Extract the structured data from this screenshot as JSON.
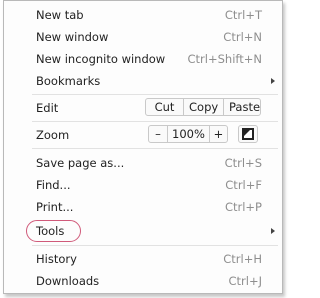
{
  "menu": {
    "new_tab": {
      "label": "New tab",
      "shortcut": "Ctrl+T"
    },
    "new_window": {
      "label": "New window",
      "shortcut": "Ctrl+N"
    },
    "new_incognito": {
      "label": "New incognito window",
      "shortcut": "Ctrl+Shift+N"
    },
    "bookmarks": {
      "label": "Bookmarks"
    },
    "edit": {
      "label": "Edit",
      "cut": "Cut",
      "copy": "Copy",
      "paste": "Paste"
    },
    "zoom": {
      "label": "Zoom",
      "minus": "–",
      "level": "100%",
      "plus": "+"
    },
    "save_page": {
      "label": "Save page as...",
      "shortcut": "Ctrl+S"
    },
    "find": {
      "label": "Find...",
      "shortcut": "Ctrl+F"
    },
    "print": {
      "label": "Print...",
      "shortcut": "Ctrl+P"
    },
    "tools": {
      "label": "Tools"
    },
    "history": {
      "label": "History",
      "shortcut": "Ctrl+H"
    },
    "downloads": {
      "label": "Downloads",
      "shortcut": "Ctrl+J"
    }
  },
  "icons": {
    "submenu_arrow": "triangle-right",
    "fullscreen": "fullscreen-icon"
  },
  "colors": {
    "highlight_ring": "#d05a7a",
    "shortcut_text": "#8e8e8e"
  }
}
